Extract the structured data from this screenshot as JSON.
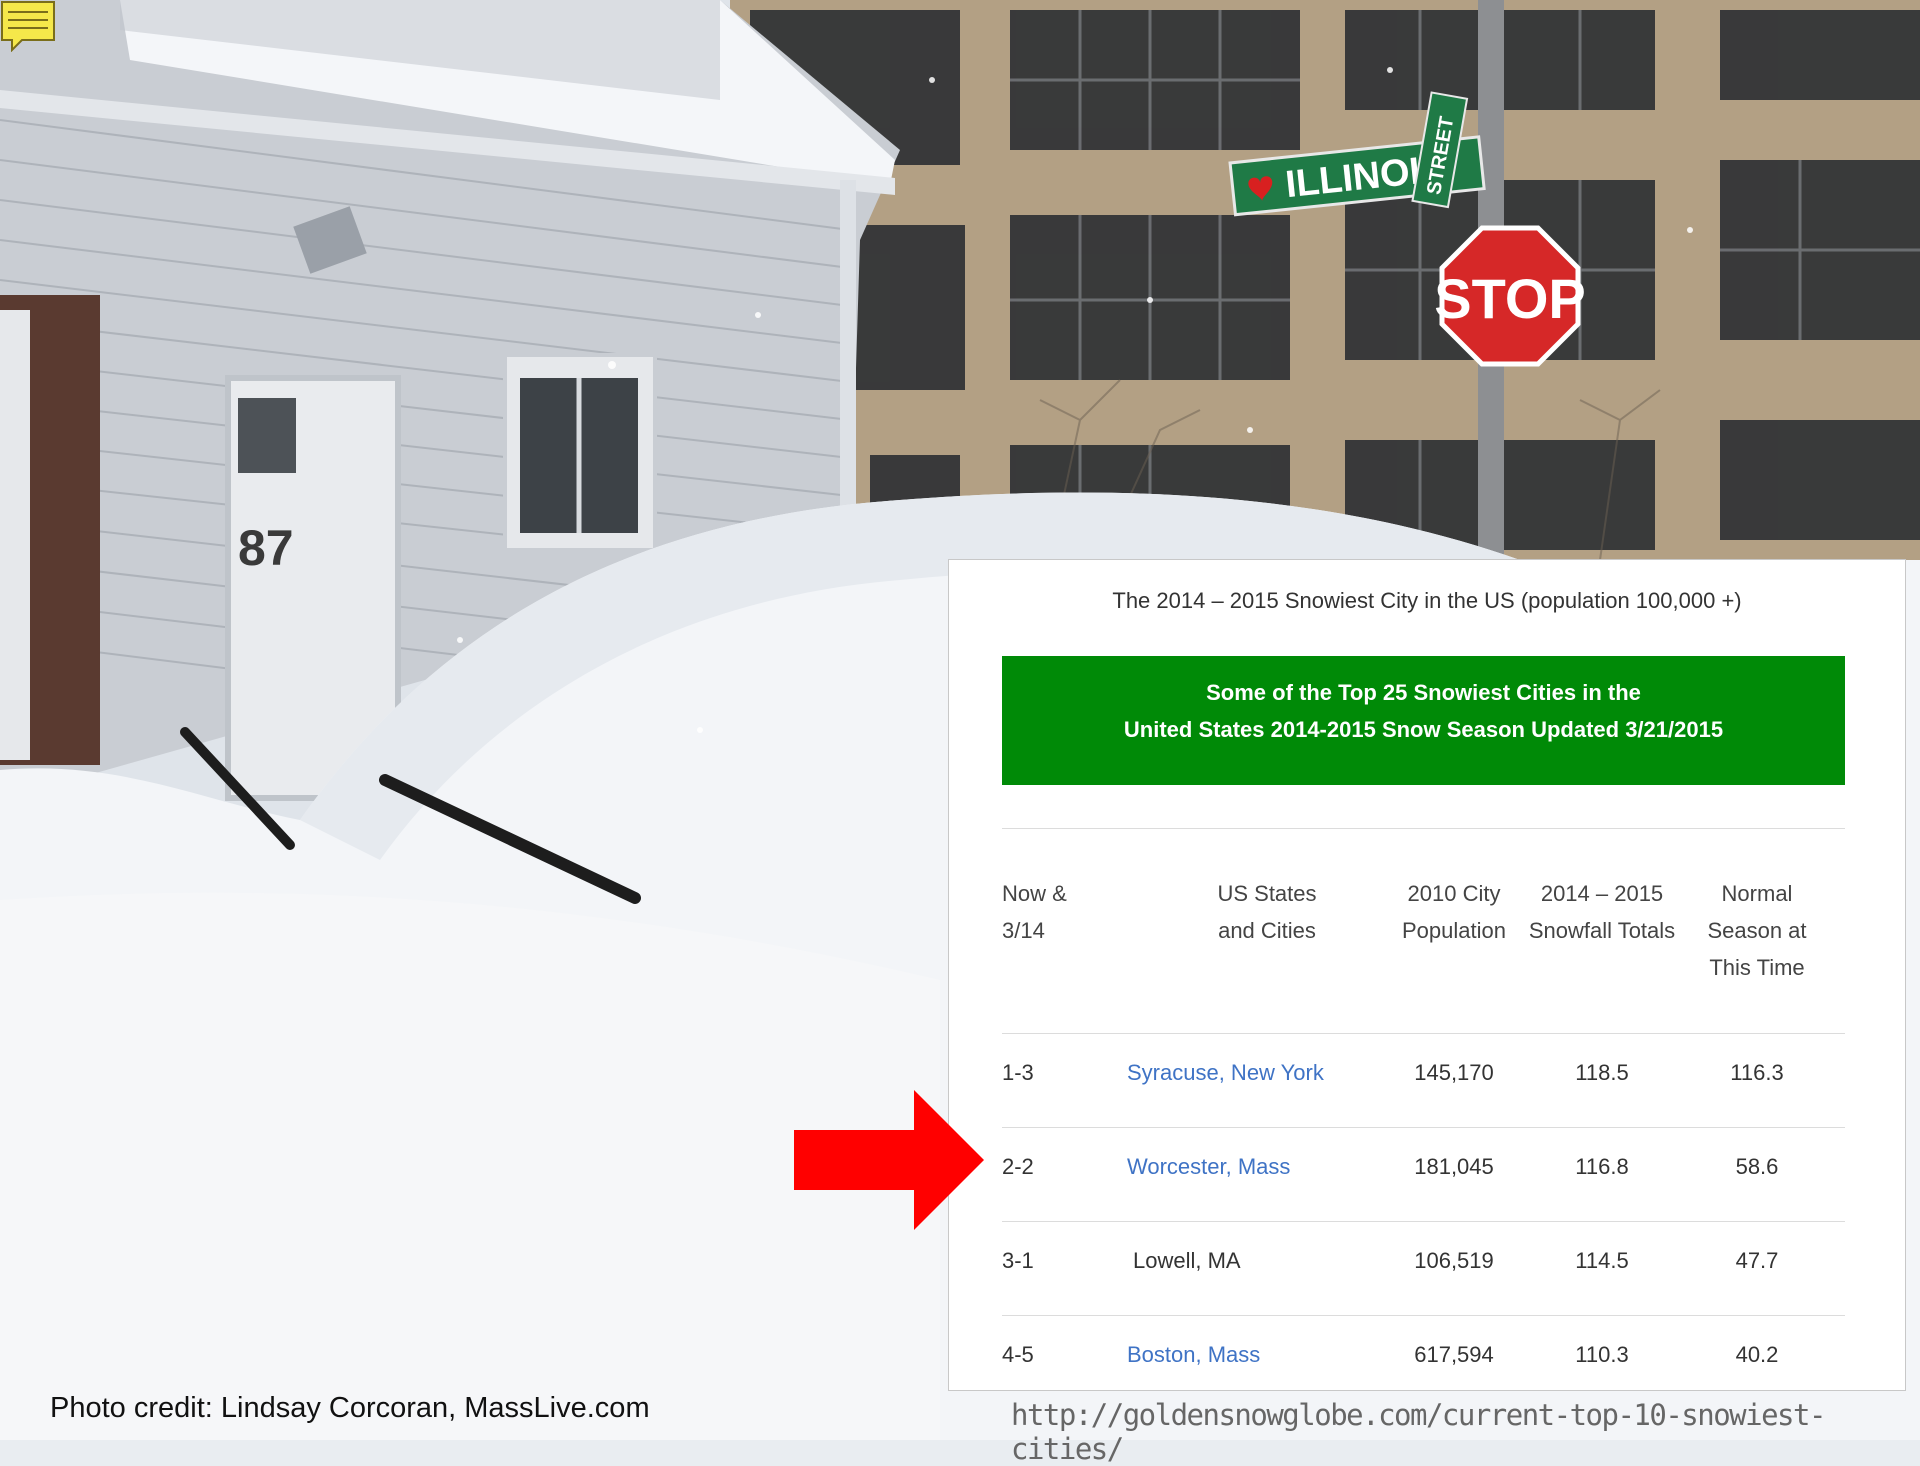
{
  "panel": {
    "caption": "The 2014 – 2015 Snowiest City in the US (population 100,000 +)",
    "banner_line1": "Some of the Top 25 Snowiest Cities in the",
    "banner_line2": "United States 2014-2015 Snow Season Updated 3/21/2015",
    "banner_color": "#008a07",
    "headers": {
      "rank": [
        "Now &",
        "3/14"
      ],
      "city": [
        "US States",
        "and Cities"
      ],
      "population": [
        "2010 City",
        "Population"
      ],
      "snowfall": [
        "2014 – 2015",
        "Snowfall Totals"
      ],
      "normal": [
        "Normal",
        "Season at",
        "This Time"
      ]
    },
    "rows": [
      {
        "rank": "1-3",
        "city": "Syracuse, New York",
        "population": "145,170",
        "snowfall": "118.5",
        "normal": "116.3"
      },
      {
        "rank": "2-2",
        "city": "Worcester, Mass",
        "population": "181,045",
        "snowfall": "116.8",
        "normal": "58.6"
      },
      {
        "rank": "3-1",
        "city": "Lowell, MA",
        "population": "106,519",
        "snowfall": "114.5",
        "normal": "47.7"
      },
      {
        "rank": "4-5",
        "city": "Boston, Mass",
        "population": "617,594",
        "snowfall": "110.3",
        "normal": "40.2"
      }
    ],
    "link_color": "#3f73c5"
  },
  "arrow_color": "#ff0000",
  "credit": "Photo credit: Lindsay Corcoran, MassLive.com",
  "source_url": "http://goldensnowglobe.com/current-top-10-snowiest-cities/",
  "street_sign": "ILLINOIS",
  "street_sign_suffix": "STREET",
  "stop_sign": "STOP",
  "house_number": "87"
}
